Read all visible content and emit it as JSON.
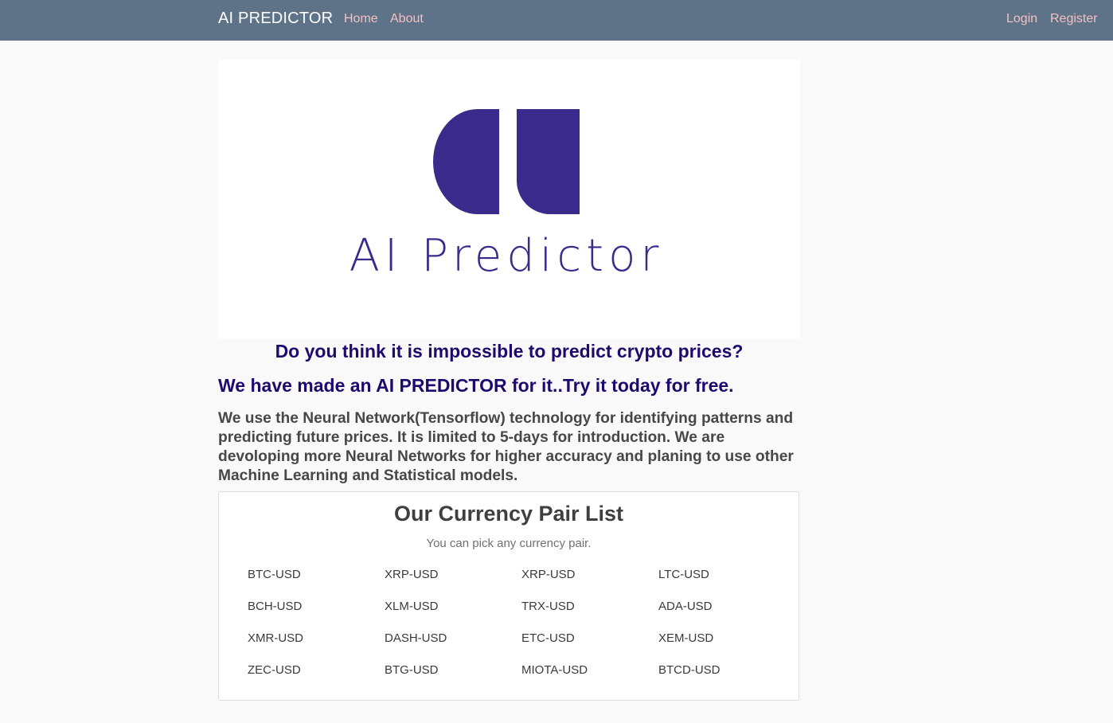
{
  "navbar": {
    "brand": "AI PREDICTOR",
    "links": [
      "Home",
      "About"
    ],
    "auth": [
      "Login",
      "Register"
    ]
  },
  "hero": {
    "logo_text": "AI Predictor",
    "logo_color": "#3a2a8c"
  },
  "headlines": {
    "question": "Do you think it is impossible to predict crypto prices?",
    "tagline": "We have made an AI PREDICTOR for it..Try it today for free."
  },
  "intro": "We use the Neural Network(Tensorflow) technology for identifying patterns and predicting future prices. It is limited to 5-days for introduction. We are devoloping more Neural Networks for higher accuracy and planing to use other Machine Learning and Statistical models.",
  "pairs": {
    "title": "Our Currency Pair List",
    "subtitle": "You can pick any currency pair.",
    "items": [
      "BTC-USD",
      "XRP-USD",
      "XRP-USD",
      "LTC-USD",
      "BCH-USD",
      "XLM-USD",
      "TRX-USD",
      "ADA-USD",
      "XMR-USD",
      "DASH-USD",
      "ETC-USD",
      "XEM-USD",
      "ZEC-USD",
      "BTG-USD",
      "MIOTA-USD",
      "BTCD-USD"
    ]
  },
  "colors": {
    "navbar_bg": "#5f7388",
    "nav_link": "#f1c1c3",
    "headline": "#1e0a6e"
  }
}
